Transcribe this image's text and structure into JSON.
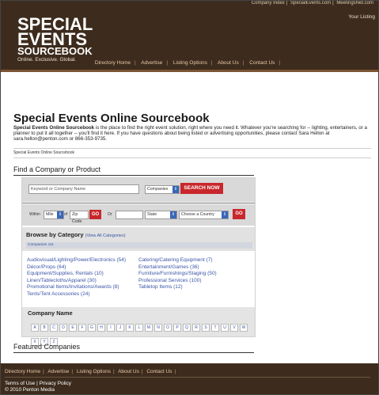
{
  "header": {
    "top_links": [
      "Company Index",
      "SpecialEvents.com",
      "MeetingsNet.com"
    ],
    "your_listing": "Your Listing",
    "logo": {
      "line1": "SPECIAL",
      "line2": "EVENTS",
      "line3": "SOURCEBOOK",
      "tagline": "Online. Exclusive. Global."
    },
    "nav": [
      "Directory Home",
      "Advertise",
      "Listing Options",
      "About Us",
      "Contact Us"
    ]
  },
  "page": {
    "title": "Special Events Online Sourcebook",
    "intro_bold": "Special Events Online Sourcebook",
    "intro_text": " is the place to find the right event solution, right where you need it. Whatever you're searching for -- lighting, entertainers, or a planner to put it all together -- you'll find it here. If you have questions about being listed or advertising opportunities, please contact Sara Hellon at sara.hellon@penton.com or 866-353-9735.",
    "breadcrumb": "Special Events Online Sourcebook"
  },
  "find": {
    "heading": "Find a Company or Product",
    "keyword_placeholder": "Keyword or Company Name",
    "type_select": "Companies",
    "search_button": "SEARCH NOW",
    "within_label": "Within",
    "miles_select": "Mile",
    "of_label": "of",
    "zip_placeholder": "Zip Code",
    "go_label": "GO",
    "or_label": "Or",
    "state_select": "State",
    "country_select": "Choose a Country"
  },
  "browse": {
    "heading": "Browse by Category",
    "view_all": "(View All Categories)",
    "crumb": "Companies 111",
    "left": [
      "Audiovisual/Lighting/Power/Electronics (54)",
      "Décor/Props (64)",
      "Equipment/Supplies, Rentals (10)",
      "Linen/Tablecloths/Apparel (30)",
      "Promotional Items/Invitations/Awards (8)",
      "Tents/Tent Accessories (24)"
    ],
    "right": [
      "Catering/Catering Equipment (7)",
      "Entertainment/Games (36)",
      "Furniture/Furnishings/Staging (50)",
      "Professional Services (100)",
      "Tabletop Items (12)"
    ]
  },
  "company": {
    "heading": "Company Name",
    "letters": [
      "A",
      "B",
      "C",
      "D",
      "E",
      "F",
      "G",
      "H",
      "I",
      "J",
      "K",
      "L",
      "M",
      "N",
      "O",
      "P",
      "Q",
      "R",
      "S",
      "T",
      "U",
      "V",
      "W",
      "X",
      "Y",
      "Z"
    ]
  },
  "featured": {
    "heading": "Featured Companies"
  },
  "footer": {
    "nav": [
      "Directory Home",
      "Advertise",
      "Listing Options",
      "About Us",
      "Contact Us"
    ],
    "terms": "Terms of Use | Privacy Policy",
    "copyright": "© 2010 Penton Media"
  },
  "colors": {
    "header_bg": "#3d2c1e",
    "nav_text": "#e9c9a6",
    "button_red": "#c8272c",
    "link_blue": "#3a55a6"
  }
}
